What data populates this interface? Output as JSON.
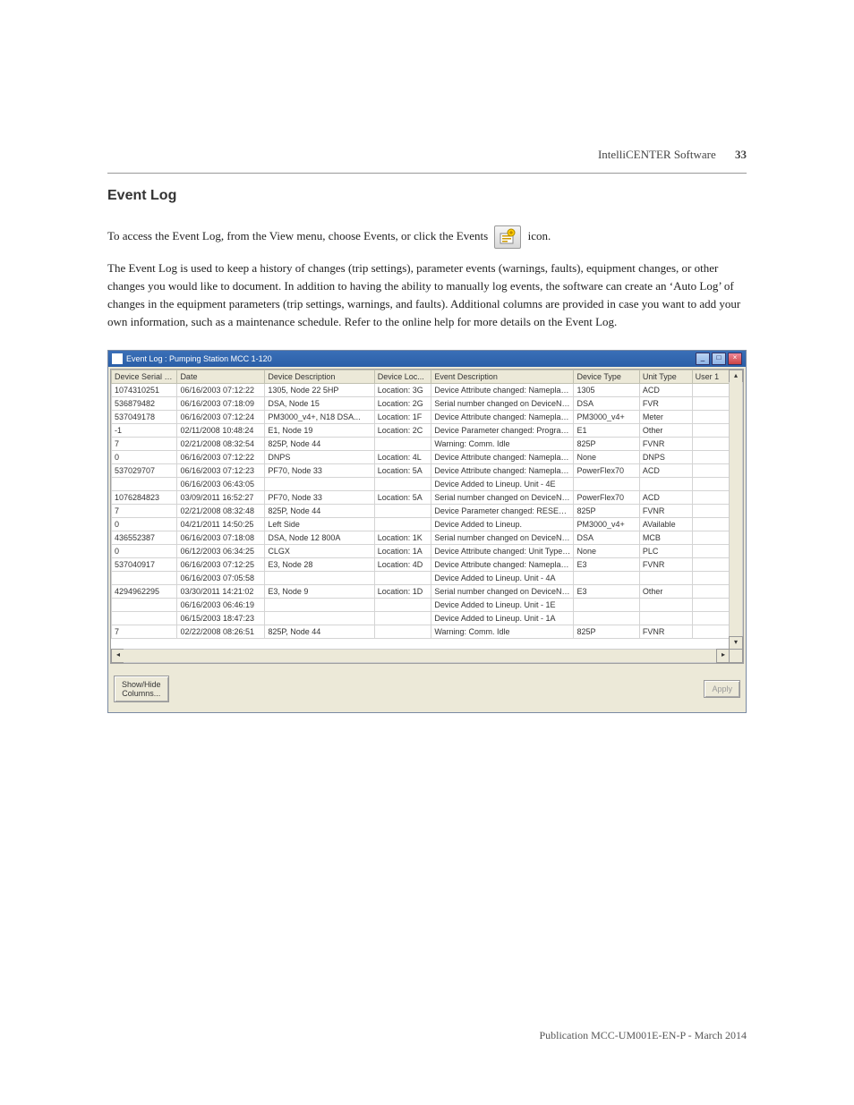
{
  "header": {
    "doc_section": "IntelliCENTER Software",
    "page_number": "33"
  },
  "section": {
    "heading": "Event Log",
    "intro_prefix": "To access the Event Log, from the View menu, choose Events, or click the Events ",
    "intro_suffix": " icon.",
    "body": "The Event Log is used to keep a history of changes (trip settings), parameter events (warnings, faults), equipment changes, or other changes you would like to document. In addition to having the ability to manually log events, the software can create an ‘Auto Log’ of changes in the equipment parameters (trip settings, warnings, and faults). Additional columns are provided in case you want to add your own information, such as a maintenance schedule. Refer to the online help for more details on the Event Log."
  },
  "window": {
    "title": "Event Log : Pumping Station MCC 1-120",
    "columns": [
      "Device Serial N...",
      "Date",
      "Device Description",
      "Device Loc...",
      "Event Description",
      "Device Type",
      "Unit Type",
      "User 1"
    ],
    "rows": [
      {
        "serial": "1074310251",
        "date": "06/16/2003 07:12:22",
        "devdesc": "1305, Node 22 5HP",
        "loc": "Location: 3G",
        "evdesc": "Device Attribute changed: Nameplate ...",
        "devtype": "1305",
        "unittype": "ACD",
        "user": ""
      },
      {
        "serial": "536879482",
        "date": "06/16/2003 07:18:09",
        "devdesc": "DSA, Node 15",
        "loc": "Location: 2G",
        "evdesc": "Serial number changed on DeviceNet ...",
        "devtype": "DSA",
        "unittype": "FVR",
        "user": ""
      },
      {
        "serial": "537049178",
        "date": "06/16/2003 07:12:24",
        "devdesc": "PM3000_v4+, N18 DSA...",
        "loc": "Location: 1F",
        "evdesc": "Device Attribute changed: Nameplate ...",
        "devtype": "PM3000_v4+",
        "unittype": "Meter",
        "user": ""
      },
      {
        "serial": "-1",
        "date": "02/11/2008 10:48:24",
        "devdesc": "E1, Node 19",
        "loc": "Location: 2C",
        "evdesc": "Device Parameter changed: Program ...",
        "devtype": "E1",
        "unittype": "Other",
        "user": ""
      },
      {
        "serial": "7",
        "date": "02/21/2008 08:32:54",
        "devdesc": "825P, Node 44",
        "loc": "",
        "evdesc": "Warning: Comm. Idle",
        "devtype": "825P",
        "unittype": "FVNR",
        "user": ""
      },
      {
        "serial": "0",
        "date": "06/16/2003 07:12:22",
        "devdesc": "DNPS",
        "loc": "Location: 4L",
        "evdesc": "Device Attribute changed: Nameplate ...",
        "devtype": "None",
        "unittype": "DNPS",
        "user": ""
      },
      {
        "serial": "537029707",
        "date": "06/16/2003 07:12:23",
        "devdesc": "PF70, Node 33",
        "loc": "Location: 5A",
        "evdesc": "Device Attribute changed: Nameplate ...",
        "devtype": "PowerFlex70",
        "unittype": "ACD",
        "user": ""
      },
      {
        "serial": "",
        "date": "06/16/2003 06:43:05",
        "devdesc": "",
        "loc": "",
        "evdesc": "Device Added to Lineup.  Unit - 4E",
        "devtype": "",
        "unittype": "",
        "user": ""
      },
      {
        "serial": "1076284823",
        "date": "03/09/2011 16:52:27",
        "devdesc": "PF70, Node 33",
        "loc": "Location: 5A",
        "evdesc": "Serial number changed on DeviceNet ...",
        "devtype": "PowerFlex70",
        "unittype": "ACD",
        "user": ""
      },
      {
        "serial": "7",
        "date": "02/21/2008 08:32:48",
        "devdesc": "825P, Node 44",
        "loc": "",
        "evdesc": "Device Parameter changed: RESET T...",
        "devtype": "825P",
        "unittype": "FVNR",
        "user": ""
      },
      {
        "serial": "0",
        "date": "04/21/2011 14:50:25",
        "devdesc": "Left Side",
        "loc": "",
        "evdesc": "Device Added to Lineup.",
        "devtype": "PM3000_v4+",
        "unittype": "AVailable",
        "user": ""
      },
      {
        "serial": "436552387",
        "date": "06/16/2003 07:18:08",
        "devdesc": "DSA, Node 12 800A",
        "loc": "Location: 1K",
        "evdesc": "Serial number changed on DeviceNet ...",
        "devtype": "DSA",
        "unittype": "MCB",
        "user": ""
      },
      {
        "serial": "0",
        "date": "06/12/2003 06:34:25",
        "devdesc": "CLGX",
        "loc": "Location: 1A",
        "evdesc": "Device Attribute changed: Unit Type= ...",
        "devtype": "None",
        "unittype": "PLC",
        "user": ""
      },
      {
        "serial": "537040917",
        "date": "06/16/2003 07:12:25",
        "devdesc": "E3, Node 28",
        "loc": "Location: 4D",
        "evdesc": "Device Attribute changed: Nameplate ...",
        "devtype": "E3",
        "unittype": "FVNR",
        "user": ""
      },
      {
        "serial": "",
        "date": "06/16/2003 07:05:58",
        "devdesc": "",
        "loc": "",
        "evdesc": "Device Added to Lineup.  Unit - 4A",
        "devtype": "",
        "unittype": "",
        "user": ""
      },
      {
        "serial": "4294962295",
        "date": "03/30/2011 14:21:02",
        "devdesc": "E3, Node 9",
        "loc": "Location: 1D",
        "evdesc": "Serial number changed on DeviceNet ...",
        "devtype": "E3",
        "unittype": "Other",
        "user": ""
      },
      {
        "serial": "",
        "date": "06/16/2003 06:46:19",
        "devdesc": "",
        "loc": "",
        "evdesc": "Device Added to Lineup.  Unit - 1E",
        "devtype": "",
        "unittype": "",
        "user": ""
      },
      {
        "serial": "",
        "date": "06/15/2003 18:47:23",
        "devdesc": "",
        "loc": "",
        "evdesc": "Device Added to Lineup.  Unit - 1A",
        "devtype": "",
        "unittype": "",
        "user": ""
      },
      {
        "serial": "7",
        "date": "02/22/2008 08:26:51",
        "devdesc": "825P, Node 44",
        "loc": "",
        "evdesc": "Warning: Comm. Idle",
        "devtype": "825P",
        "unittype": "FVNR",
        "user": ""
      }
    ],
    "buttons": {
      "show_hide": "Show/Hide\nColumns...",
      "apply": "Apply"
    }
  },
  "footer": {
    "publication": "Publication MCC-UM001E-EN-P - March 2014"
  }
}
